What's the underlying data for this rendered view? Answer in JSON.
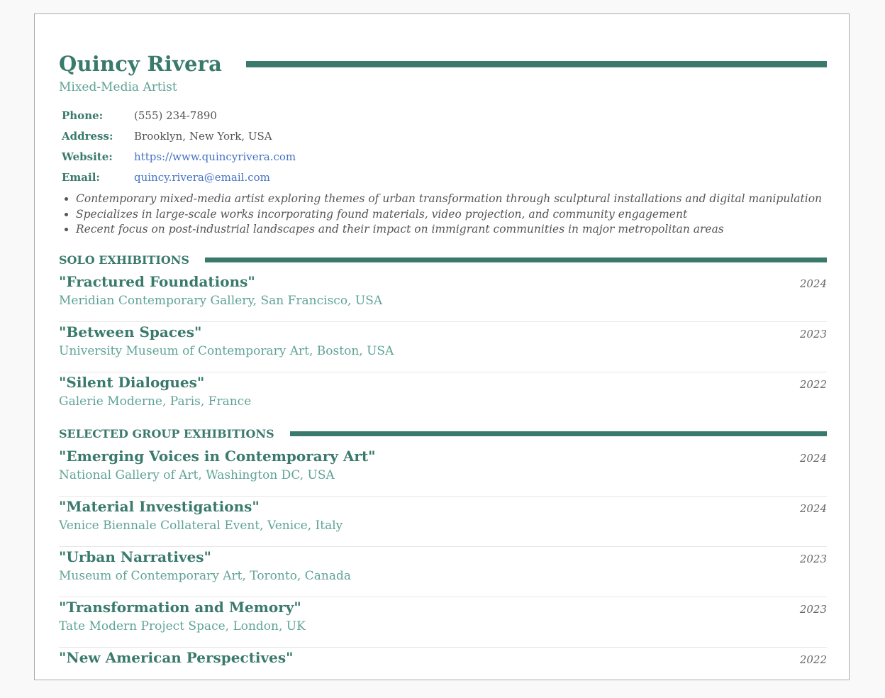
{
  "header": {
    "name": "Quincy Rivera",
    "title": "Mixed-Media Artist"
  },
  "contact": [
    {
      "label": "Phone:",
      "value": "(555) 234-7890"
    },
    {
      "label": "Address:",
      "value": "Brooklyn, New York, USA"
    },
    {
      "label": "Website:",
      "value": "https://www.quincyrivera.com"
    },
    {
      "label": "Email:",
      "value": "quincy.rivera@email.com"
    }
  ],
  "summary": [
    "Contemporary mixed-media artist exploring themes of urban transformation through sculptural installations and digital manipulation",
    "Specializes in large-scale works incorporating found materials, video projection, and community engagement",
    "Recent focus on post-industrial landscapes and their impact on immigrant communities in major metropolitan areas"
  ],
  "solo": {
    "heading": "SOLO EXHIBITIONS",
    "items": [
      {
        "title": "\"Fractured Foundations\"",
        "venue": "Meridian Contemporary Gallery, San Francisco, USA",
        "year": "2024"
      },
      {
        "title": "\"Between Spaces\"",
        "venue": "University Museum of Contemporary Art, Boston, USA",
        "year": "2023"
      },
      {
        "title": "\"Silent Dialogues\"",
        "venue": "Galerie Moderne, Paris, France",
        "year": "2022"
      }
    ]
  },
  "group": {
    "heading": "SELECTED GROUP EXHIBITIONS",
    "items": [
      {
        "title": "\"Emerging Voices in Contemporary Art\"",
        "venue": "National Gallery of Art, Washington DC, USA",
        "year": "2024"
      },
      {
        "title": "\"Material Investigations\"",
        "venue": "Venice Biennale Collateral Event, Venice, Italy",
        "year": "2024"
      },
      {
        "title": "\"Urban Narratives\"",
        "venue": "Museum of Contemporary Art, Toronto, Canada",
        "year": "2023"
      },
      {
        "title": "\"Transformation and Memory\"",
        "venue": "Tate Modern Project Space, London, UK",
        "year": "2023"
      },
      {
        "title": "\"New American Perspectives\"",
        "venue": "",
        "year": "2022"
      }
    ]
  },
  "colors": {
    "accent": "#3a7a6c",
    "accent_light": "#5fa396",
    "link": "#4472c4"
  }
}
